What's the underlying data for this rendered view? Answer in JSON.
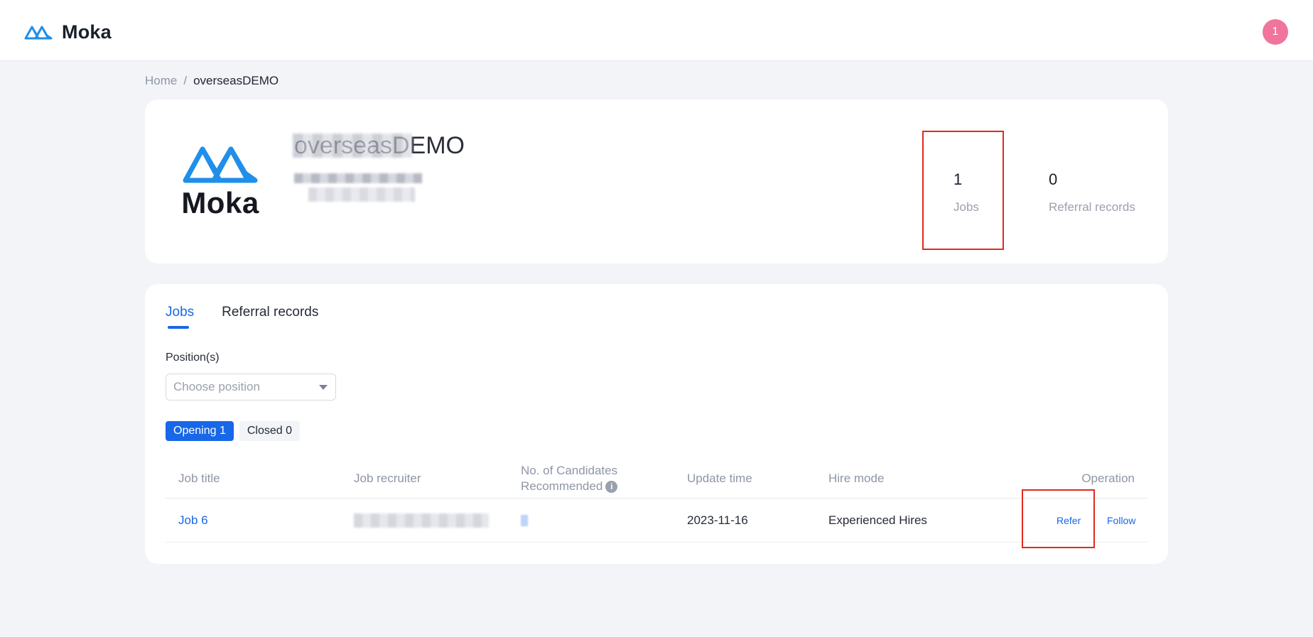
{
  "header": {
    "brand_name": "Moka",
    "avatar_label": "1",
    "logo_icon": "moka-mountain-icon"
  },
  "breadcrumb": {
    "home": "Home",
    "separator": "/",
    "current": "overseasDEMO"
  },
  "company": {
    "logo_word": "Moka",
    "name": "overseasDEMO",
    "stats": [
      {
        "value": "1",
        "label": "Jobs"
      },
      {
        "value": "0",
        "label": "Referral records"
      }
    ]
  },
  "tabs": [
    {
      "label": "Jobs",
      "active": true
    },
    {
      "label": "Referral records",
      "active": false
    }
  ],
  "filter": {
    "label": "Position(s)",
    "placeholder": "Choose position"
  },
  "status": {
    "opening": "Opening 1",
    "closed": "Closed 0"
  },
  "table": {
    "headers": {
      "job_title": "Job title",
      "job_recruiter": "Job recruiter",
      "candidates_line1": "No. of Candidates",
      "candidates_line2": "Recommended",
      "update_time": "Update time",
      "hire_mode": "Hire mode",
      "operation": "Operation"
    },
    "rows": [
      {
        "job_title": "Job 6",
        "update_time": "2023-11-16",
        "hire_mode": "Experienced Hires",
        "refer": "Refer",
        "follow": "Follow"
      }
    ]
  },
  "colors": {
    "accent": "#1767e8",
    "highlight": "#e12a1f",
    "avatar": "#f0749b"
  }
}
